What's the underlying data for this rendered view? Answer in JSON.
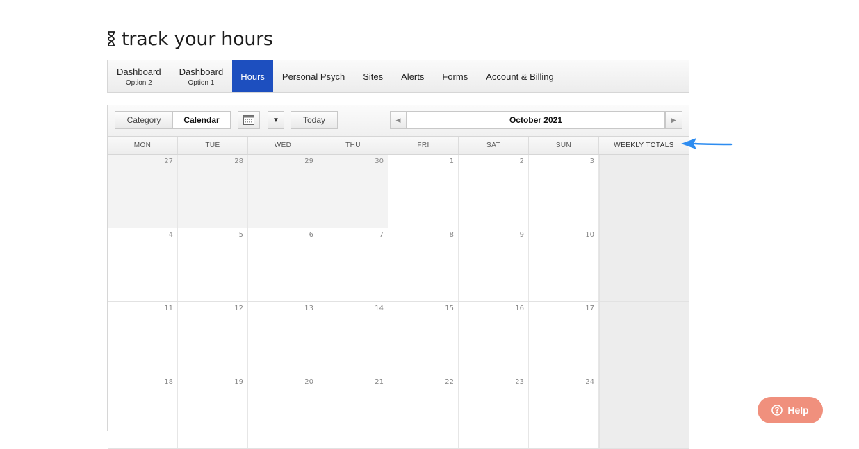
{
  "app": {
    "title": "track your hours"
  },
  "nav": {
    "items": [
      {
        "label": "Dashboard",
        "sub": "Option 2",
        "active": false
      },
      {
        "label": "Dashboard",
        "sub": "Option 1",
        "active": false
      },
      {
        "label": "Hours",
        "sub": "",
        "active": true
      },
      {
        "label": "Personal Psych",
        "sub": "",
        "active": false
      },
      {
        "label": "Sites",
        "sub": "",
        "active": false
      },
      {
        "label": "Alerts",
        "sub": "",
        "active": false
      },
      {
        "label": "Forms",
        "sub": "",
        "active": false
      },
      {
        "label": "Account & Billing",
        "sub": "",
        "active": false
      }
    ]
  },
  "toolbar": {
    "category_label": "Category",
    "calendar_label": "Calendar",
    "today_label": "Today",
    "month_label": "October 2021",
    "prev_icon": "left-triangle",
    "next_icon": "right-triangle",
    "view_icon": "calendar-grid-icon",
    "dropdown_icon": "down-triangle"
  },
  "calendar": {
    "headers": [
      "MON",
      "TUE",
      "WED",
      "THU",
      "FRI",
      "SAT",
      "SUN"
    ],
    "totals_header": "WEEKLY TOTALS",
    "weeks": [
      [
        {
          "n": "27",
          "other": true
        },
        {
          "n": "28",
          "other": true
        },
        {
          "n": "29",
          "other": true
        },
        {
          "n": "30",
          "other": true
        },
        {
          "n": "1",
          "other": false
        },
        {
          "n": "2",
          "other": false
        },
        {
          "n": "3",
          "other": false
        }
      ],
      [
        {
          "n": "4",
          "other": false
        },
        {
          "n": "5",
          "other": false
        },
        {
          "n": "6",
          "other": false
        },
        {
          "n": "7",
          "other": false
        },
        {
          "n": "8",
          "other": false
        },
        {
          "n": "9",
          "other": false
        },
        {
          "n": "10",
          "other": false
        }
      ],
      [
        {
          "n": "11",
          "other": false
        },
        {
          "n": "12",
          "other": false
        },
        {
          "n": "13",
          "other": false
        },
        {
          "n": "14",
          "other": false
        },
        {
          "n": "15",
          "other": false
        },
        {
          "n": "16",
          "other": false
        },
        {
          "n": "17",
          "other": false
        }
      ],
      [
        {
          "n": "18",
          "other": false
        },
        {
          "n": "19",
          "other": false
        },
        {
          "n": "20",
          "other": false
        },
        {
          "n": "21",
          "other": false
        },
        {
          "n": "22",
          "other": false
        },
        {
          "n": "23",
          "other": false
        },
        {
          "n": "24",
          "other": false
        }
      ]
    ]
  },
  "help": {
    "label": "Help",
    "icon": "question-circle-icon"
  },
  "colors": {
    "active_nav": "#1d4fbf",
    "help_button": "#f0907d",
    "pointer_arrow": "#2d8cf0"
  }
}
